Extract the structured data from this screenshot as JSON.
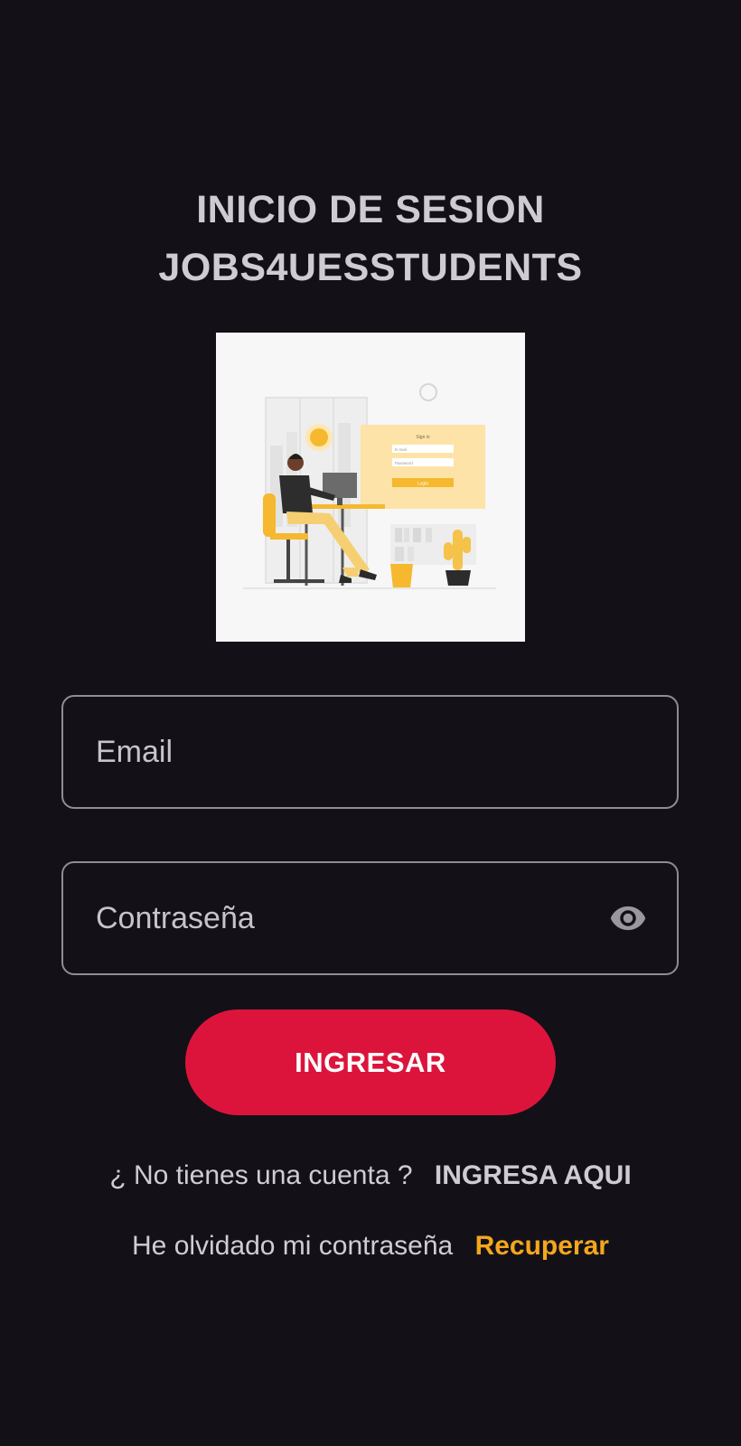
{
  "header": {
    "title_line1": "INICIO DE SESION",
    "title_line2": "JOBS4UESSTUDENTS"
  },
  "illustration": {
    "form_title": "Sign in",
    "email_label": "E-mail",
    "password_label": "Password",
    "button_label": "Login"
  },
  "form": {
    "email_placeholder": "Email",
    "password_placeholder": "Contraseña",
    "submit_label": "INGRESAR"
  },
  "register": {
    "prompt": "¿ No tienes una cuenta ?",
    "link": "INGRESA AQUI"
  },
  "recover": {
    "prompt": "He olvidado mi contraseña",
    "link": "Recuperar"
  },
  "icons": {
    "password_toggle": "eye-icon"
  },
  "colors": {
    "background": "#131117",
    "primary_button": "#dc143c",
    "recover_link": "#f4a61d",
    "illustration_accent": "#f5b82e"
  }
}
